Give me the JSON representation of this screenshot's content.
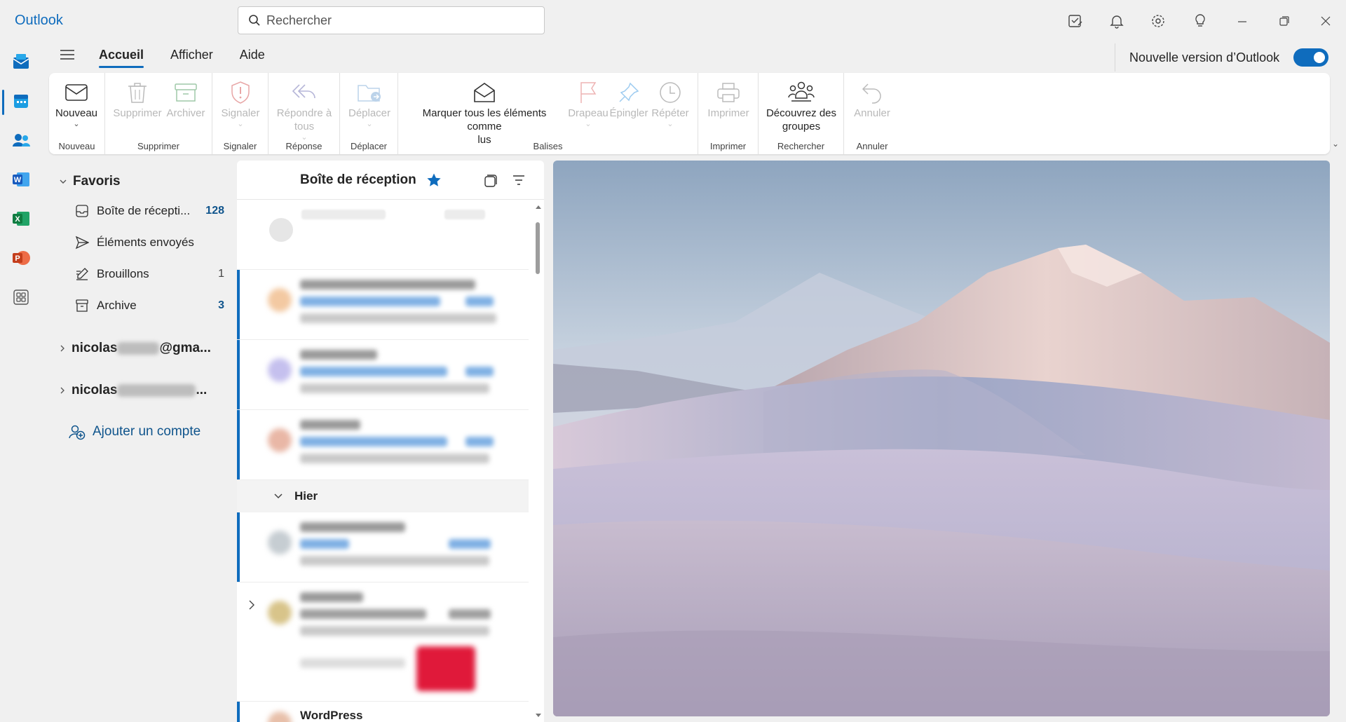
{
  "app": {
    "title": "Outlook"
  },
  "search": {
    "placeholder": "Rechercher"
  },
  "titlebar": {
    "icons": [
      "my-day-icon",
      "bell-icon",
      "gear-icon",
      "lightbulb-icon",
      "minimize-icon",
      "restore-icon",
      "close-icon"
    ]
  },
  "rail": {
    "items": [
      "mail-icon",
      "calendar-icon",
      "people-icon",
      "word-icon",
      "excel-icon",
      "powerpoint-icon",
      "apps-icon"
    ]
  },
  "tabs": [
    {
      "label": "Accueil",
      "active": true
    },
    {
      "label": "Afficher",
      "active": false
    },
    {
      "label": "Aide",
      "active": false
    }
  ],
  "new_version": {
    "label": "Nouvelle version d’Outlook",
    "enabled": true
  },
  "ribbon": {
    "groups": {
      "nouveau": {
        "label": "Nouveau",
        "new_btn": "Nouveau"
      },
      "supprimer": {
        "label": "Supprimer",
        "delete_btn": "Supprimer",
        "archive_btn": "Archiver"
      },
      "signaler": {
        "label": "Signaler",
        "report_btn": "Signaler"
      },
      "reponse": {
        "label": "Réponse",
        "reply_all_line1": "Répondre à",
        "reply_all_line2": "tous"
      },
      "deplacer": {
        "label": "Déplacer",
        "move_btn": "Déplacer"
      },
      "balises": {
        "label": "Balises",
        "mark_read_line1": "Marquer tous les éléments comme",
        "mark_read_line2": "lus",
        "flag_btn": "Drapeau",
        "pin_btn": "Épingler",
        "snooze_btn": "Répéter"
      },
      "imprimer": {
        "label": "Imprimer",
        "print_btn": "Imprimer"
      },
      "rechercher": {
        "label": "Rechercher",
        "groups_line1": "Découvrez des",
        "groups_line2": "groupes"
      },
      "annuler": {
        "label": "Annuler",
        "undo_btn": "Annuler"
      }
    }
  },
  "folders": {
    "favorites_label": "Favoris",
    "items": [
      {
        "name": "Boîte de récepti...",
        "count": "128",
        "icon": "inbox-icon"
      },
      {
        "name": "Éléments envoyés",
        "count": "",
        "icon": "send-icon"
      },
      {
        "name": "Brouillons",
        "count": "1",
        "icon": "drafts-icon"
      },
      {
        "name": "Archive",
        "count": "3",
        "icon": "archive-icon"
      }
    ],
    "accounts": [
      {
        "prefix": "nicolas",
        "suffix": "@gma..."
      },
      {
        "prefix": "nicolas",
        "suffix": "..."
      }
    ],
    "add_account": "Ajouter un compte"
  },
  "message_list": {
    "title": "Boîte de réception",
    "day_header": "Hier",
    "last_sender": "WordPress"
  },
  "colors": {
    "accent": "#0f6cbd",
    "unread_bar": "#0f6cbd",
    "count_blue": "#0f548c"
  }
}
